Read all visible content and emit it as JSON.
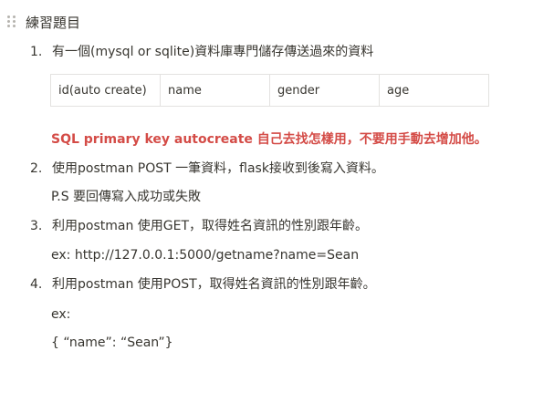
{
  "heading": {
    "title": "練習題目"
  },
  "items": [
    {
      "number": "1.",
      "text": "有一個(mysql or sqlite)資料庫專門儲存傳送過來的資料"
    },
    {
      "number": "2.",
      "text": "使用postman POST 一筆資料，flask接收到後寫入資料。"
    },
    {
      "number": "3.",
      "text": "利用postman 使用GET，取得姓名資訊的性別跟年齡。"
    },
    {
      "number": "4.",
      "text": "利用postman 使用POST，取得姓名資訊的性別跟年齡。"
    }
  ],
  "table": {
    "columns": [
      "id(auto create)",
      "name",
      "gender",
      "age"
    ]
  },
  "note": {
    "text": "SQL primary key autocreate 自己去找怎樣用，不要用手動去增加他。",
    "color": "#d44c47"
  },
  "item2_detail": "P.S 要回傳寫入成功或失敗",
  "item3_detail": "ex: http://127.0.0.1:5000/getname?name=Sean",
  "item4_detail": {
    "line1": "ex:",
    "line2": "{ “name”: “Sean”}"
  }
}
